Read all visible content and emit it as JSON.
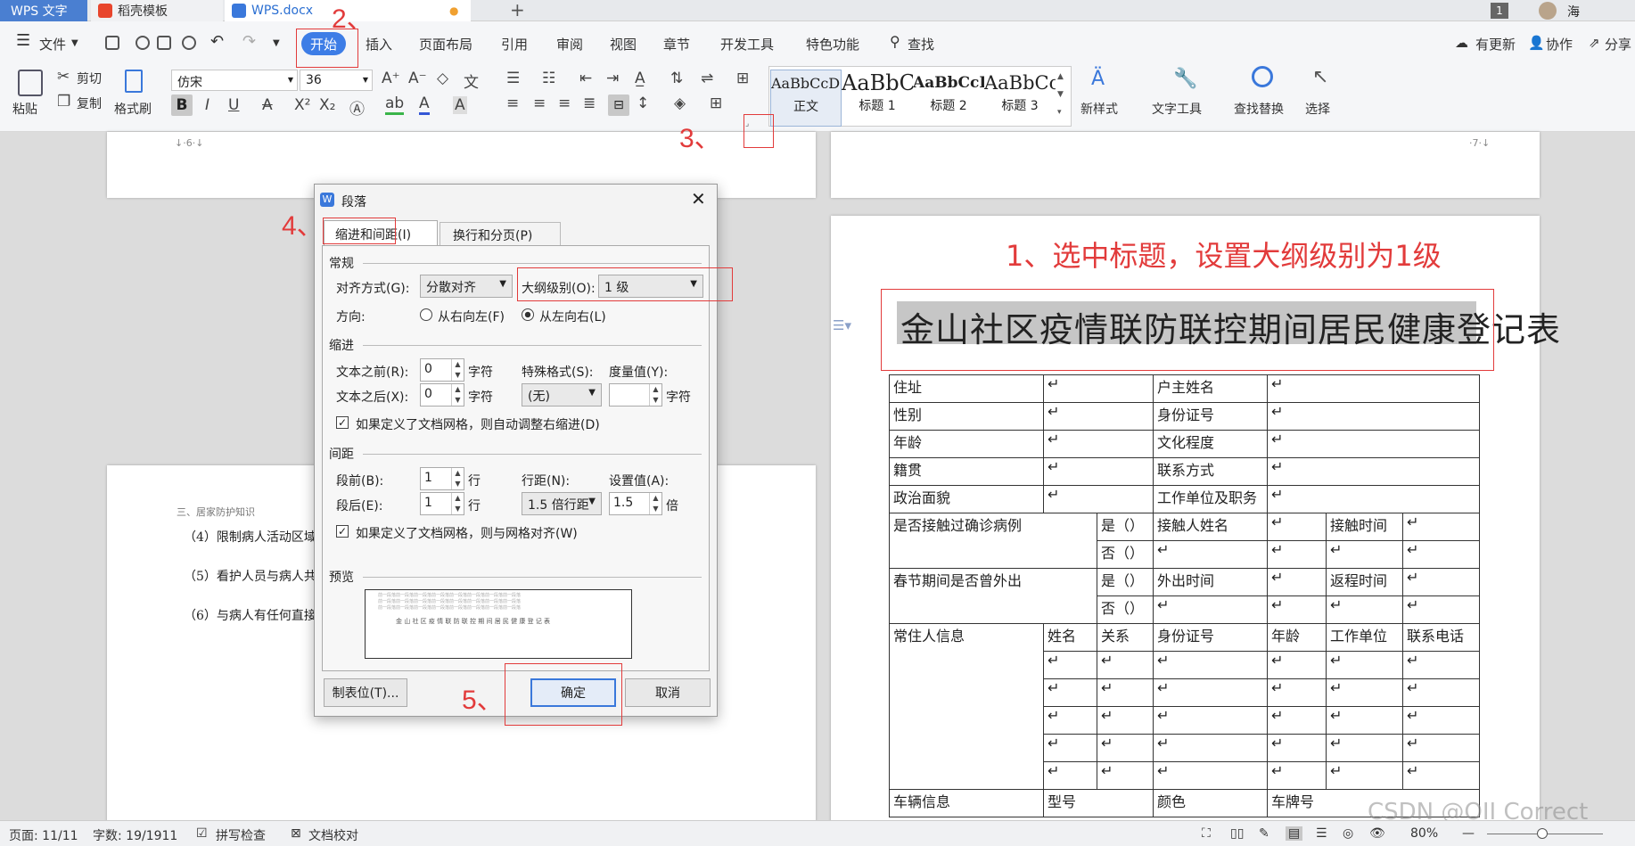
{
  "tabs": {
    "app": "WPS 文字",
    "template": "稻壳模板",
    "doc": "WPS.docx"
  },
  "menu": {
    "file": "文件",
    "items": [
      "开始",
      "插入",
      "页面布局",
      "引用",
      "审阅",
      "视图",
      "章节",
      "开发工具",
      "特色功能"
    ],
    "search": "查找",
    "update": "有更新",
    "collab": "协作",
    "share": "分享",
    "user": "海",
    "badge": "1"
  },
  "ribbon": {
    "paste": "粘贴",
    "cut": "剪切",
    "copy": "复制",
    "format_painter": "格式刷",
    "font": "仿宋",
    "size": "36",
    "styles": [
      {
        "sample": "AaBbCcDd",
        "name": "正文"
      },
      {
        "sample": "AaBbC",
        "name": "标题 1"
      },
      {
        "sample": "AaBbCcDd",
        "name": "标题 2"
      },
      {
        "sample": "AaBbCc",
        "name": "标题 3"
      }
    ],
    "new_style": "新样式",
    "text_tool": "文字工具",
    "find_replace": "查找替换",
    "select": "选择"
  },
  "annotations": {
    "n1": "1、选中标题，设置大纲级别为1级",
    "n2": "2、",
    "n3": "3、",
    "n4": "4、",
    "n5": "5、"
  },
  "left_doc": {
    "header": "三、居家防护知识",
    "items": [
      "（4）限制病人活动区域",
      "（5）看护人员与病人共",
      "（6）与病人有任何直接"
    ],
    "page_no_left": "6",
    "page_no_right": "7"
  },
  "dialog": {
    "title": "段落",
    "tab_indent": "缩进和间距(I)",
    "tab_break": "换行和分页(P)",
    "sec_general": "常规",
    "align_label": "对齐方式(G):",
    "align_value": "分散对齐",
    "outline_label": "大纲级别(O):",
    "outline_value": "1 级",
    "dir_label": "方向:",
    "rtl": "从右向左(F)",
    "ltr": "从左向右(L)",
    "sec_indent": "缩进",
    "before_text": "文本之前(R):",
    "before_val": "0",
    "after_text": "文本之后(X):",
    "after_val": "0",
    "unit_char": "字符",
    "special": "特殊格式(S):",
    "special_val": "(无)",
    "measure": "度量值(Y):",
    "auto_adjust": "如果定义了文档网格，则自动调整右缩进(D)",
    "sec_spacing": "间距",
    "sp_before": "段前(B):",
    "sp_before_val": "1",
    "sp_after": "段后(E):",
    "sp_after_val": "1",
    "unit_line": "行",
    "line_label": "行距(N):",
    "line_val": "1.5 倍行距",
    "set_label": "设置值(A):",
    "set_val": "1.5",
    "unit_times": "倍",
    "snap_grid": "如果定义了文档网格，则与网格对齐(W)",
    "sec_preview": "预览",
    "preview_filler": "前一段落前一段落前一段落前一段落前一段落前一段落前一段落前一段落",
    "preview_text": "金 山 社 区 疫 情 联 防 联 控 期 间 居 民 健 康 登 记 表",
    "tabs_btn": "制表位(T)...",
    "ok": "确定",
    "cancel": "取消"
  },
  "right_doc": {
    "title": "金山社区疫情联防联控期间居民健康登记表"
  },
  "table": {
    "r_addr": "住址",
    "r_owner": "户主姓名",
    "r_gender": "性别",
    "r_id": "身份证号",
    "r_age": "年龄",
    "r_edu": "文化程度",
    "r_origin": "籍贯",
    "r_contact": "联系方式",
    "r_pol": "政治面貌",
    "r_work": "工作单位及职务",
    "r_exposed": "是否接触过确诊病例",
    "yes": "是（）",
    "no": "否（）",
    "contact_name": "接触人姓名",
    "contact_time": "接触时间",
    "r_travel": "春节期间是否曾外出",
    "out_time": "外出时间",
    "return_time": "返程时间",
    "r_resident": "常住人信息",
    "name": "姓名",
    "relation": "关系",
    "id": "身份证号",
    "age": "年龄",
    "workplace": "工作单位",
    "phone": "联系电话",
    "r_vehicle": "车辆信息",
    "model": "型号",
    "color": "颜色",
    "plate": "车牌号"
  },
  "status": {
    "page": "页面: 11/11",
    "words": "字数: 19/1911",
    "spell": "拼写检查",
    "proof": "文档校对",
    "zoom": "80%"
  },
  "watermark": "CSDN @OII Correct"
}
